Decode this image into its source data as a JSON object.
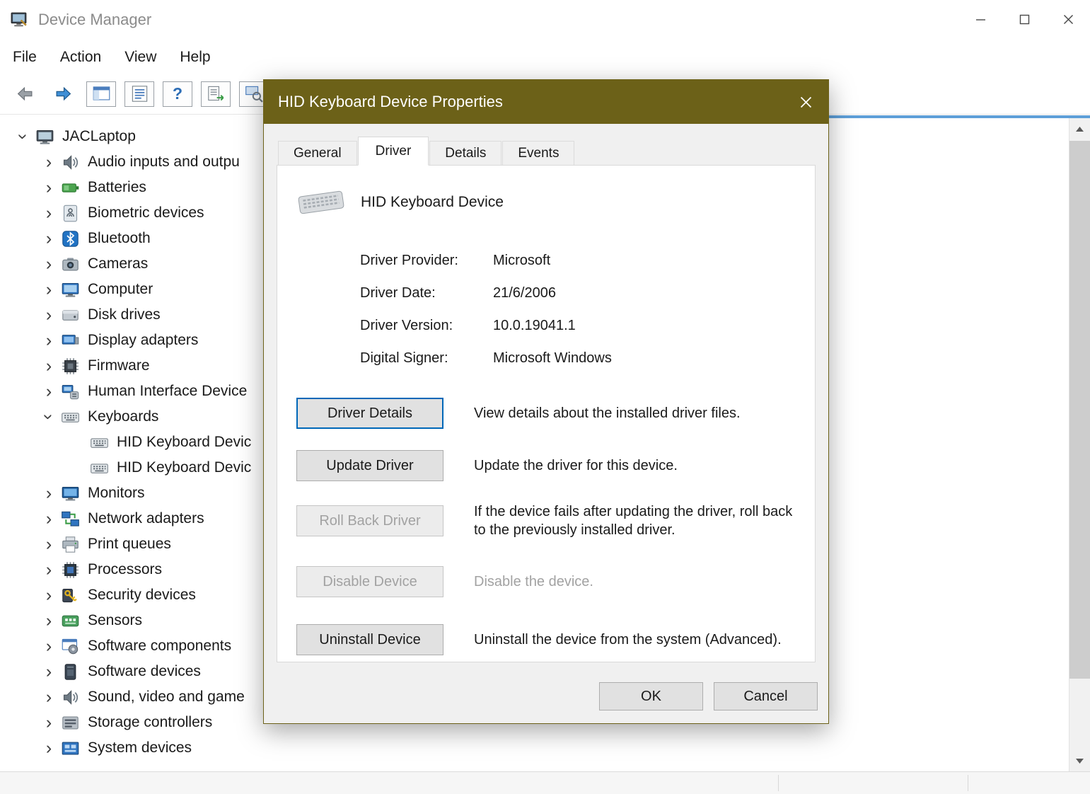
{
  "window": {
    "title": "Device Manager",
    "menu": [
      "File",
      "Action",
      "View",
      "Help"
    ]
  },
  "toolbar": {
    "items": [
      {
        "name": "back-icon",
        "framed": false
      },
      {
        "name": "forward-icon",
        "framed": false
      },
      {
        "name": "show-console-tree-icon",
        "framed": true
      },
      {
        "name": "properties-icon",
        "framed": true
      },
      {
        "name": "help-icon",
        "framed": true,
        "glyph": "?"
      },
      {
        "name": "export-list-icon",
        "framed": true
      },
      {
        "name": "scan-hardware-icon",
        "framed": true
      }
    ]
  },
  "icons": {
    "chevron_glyph": "›"
  },
  "tree": {
    "items": [
      {
        "label": "JACLaptop",
        "icon": "computer-root-icon",
        "level": 0,
        "chevron": "expanded"
      },
      {
        "label": "Audio inputs and outpu",
        "icon": "audio-icon",
        "level": 1,
        "chevron": "collapsed"
      },
      {
        "label": "Batteries",
        "icon": "battery-icon",
        "level": 1,
        "chevron": "collapsed"
      },
      {
        "label": "Biometric devices",
        "icon": "biometric-icon",
        "level": 1,
        "chevron": "collapsed"
      },
      {
        "label": "Bluetooth",
        "icon": "bluetooth-icon",
        "level": 1,
        "chevron": "collapsed"
      },
      {
        "label": "Cameras",
        "icon": "camera-icon",
        "level": 1,
        "chevron": "collapsed"
      },
      {
        "label": "Computer",
        "icon": "computer-icon",
        "level": 1,
        "chevron": "collapsed"
      },
      {
        "label": "Disk drives",
        "icon": "disk-icon",
        "level": 1,
        "chevron": "collapsed"
      },
      {
        "label": "Display adapters",
        "icon": "display-adapter-icon",
        "level": 1,
        "chevron": "collapsed"
      },
      {
        "label": "Firmware",
        "icon": "firmware-icon",
        "level": 1,
        "chevron": "collapsed"
      },
      {
        "label": "Human Interface Device",
        "icon": "hid-icon",
        "level": 1,
        "chevron": "collapsed"
      },
      {
        "label": "Keyboards",
        "icon": "keyboard-icon",
        "level": 1,
        "chevron": "expanded"
      },
      {
        "label": "HID Keyboard Devic",
        "icon": "keyboard-icon",
        "level": 2,
        "chevron": null
      },
      {
        "label": "HID Keyboard Devic",
        "icon": "keyboard-icon",
        "level": 2,
        "chevron": null
      },
      {
        "label": "Monitors",
        "icon": "monitor-icon",
        "level": 1,
        "chevron": "collapsed"
      },
      {
        "label": "Network adapters",
        "icon": "network-icon",
        "level": 1,
        "chevron": "collapsed"
      },
      {
        "label": "Print queues",
        "icon": "printer-icon",
        "level": 1,
        "chevron": "collapsed"
      },
      {
        "label": "Processors",
        "icon": "processor-icon",
        "level": 1,
        "chevron": "collapsed"
      },
      {
        "label": "Security devices",
        "icon": "security-icon",
        "level": 1,
        "chevron": "collapsed"
      },
      {
        "label": "Sensors",
        "icon": "sensors-icon",
        "level": 1,
        "chevron": "collapsed"
      },
      {
        "label": "Software components",
        "icon": "software-components-icon",
        "level": 1,
        "chevron": "collapsed"
      },
      {
        "label": "Software devices",
        "icon": "software-devices-icon",
        "level": 1,
        "chevron": "collapsed"
      },
      {
        "label": "Sound, video and game",
        "icon": "sound-icon",
        "level": 1,
        "chevron": "collapsed"
      },
      {
        "label": "Storage controllers",
        "icon": "storage-icon",
        "level": 1,
        "chevron": "collapsed"
      },
      {
        "label": "System devices",
        "icon": "system-devices-icon",
        "level": 1,
        "chevron": "collapsed"
      }
    ]
  },
  "dialog": {
    "title": "HID Keyboard Device Properties",
    "tabs": [
      "General",
      "Driver",
      "Details",
      "Events"
    ],
    "active_tab": "Driver",
    "device_name": "HID Keyboard Device",
    "device_image": "keyboard-image",
    "fields": [
      {
        "label": "Driver Provider:",
        "value": "Microsoft"
      },
      {
        "label": "Driver Date:",
        "value": "21/6/2006"
      },
      {
        "label": "Driver Version:",
        "value": "10.0.19041.1"
      },
      {
        "label": "Digital Signer:",
        "value": "Microsoft Windows"
      }
    ],
    "actions": [
      {
        "label": "Driver Details",
        "description": "View details about the installed driver files.",
        "enabled": true,
        "focused": true,
        "description_disabled": false
      },
      {
        "label": "Update Driver",
        "description": "Update the driver for this device.",
        "enabled": true,
        "focused": false,
        "description_disabled": false
      },
      {
        "label": "Roll Back Driver",
        "description": "If the device fails after updating the driver, roll back to the previously installed driver.",
        "enabled": false,
        "focused": false,
        "description_disabled": false
      },
      {
        "label": "Disable Device",
        "description": "Disable the device.",
        "enabled": false,
        "focused": false,
        "description_disabled": true
      },
      {
        "label": "Uninstall Device",
        "description": "Uninstall the device from the system (Advanced).",
        "enabled": true,
        "focused": false,
        "description_disabled": false
      }
    ],
    "ok_label": "OK",
    "cancel_label": "Cancel"
  },
  "accent_colors": {
    "dialog_titlebar": "#6c6118",
    "focus_border": "#0067b8",
    "tree_highlight_line": "#5e9fd8"
  }
}
